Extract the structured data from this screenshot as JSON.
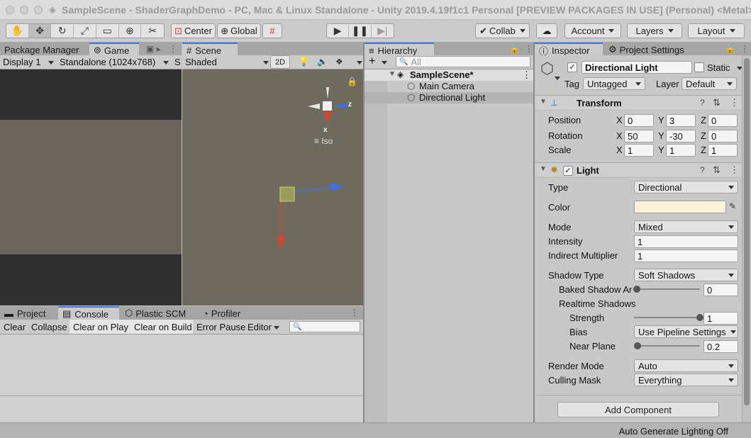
{
  "window": {
    "title": "SampleScene - ShaderGraphDemo - PC, Mac & Linux Standalone - Unity 2019.4.19f1c1 Personal [PREVIEW PACKAGES IN USE] (Personal) <Metal>"
  },
  "toolbar": {
    "tools": [
      "hand-tool",
      "move-tool",
      "rotate-tool",
      "scale-tool",
      "rect-tool",
      "transform-tool",
      "custom-tool"
    ],
    "pivot_label": "Center",
    "space_label": "Global",
    "collab_label": "Collab",
    "account_label": "Account",
    "layers_label": "Layers",
    "layout_label": "Layout"
  },
  "left_tabs": {
    "package_manager": "Package Manager",
    "game": "Game"
  },
  "game": {
    "display": "Display 1",
    "resolution": "Standalone (1024x768)",
    "scale_prefix": "S"
  },
  "scene": {
    "tab": "Scene",
    "shading": "Shaded",
    "mode_2d": "2D",
    "gizmo_x": "x",
    "gizmo_z": "z",
    "iso": "Iso"
  },
  "hierarchy": {
    "tab": "Hierarchy",
    "search_placeholder": "All",
    "scene_name": "SampleScene*",
    "items": [
      "Main Camera",
      "Directional Light"
    ]
  },
  "bottom_tabs": {
    "project": "Project",
    "console": "Console",
    "plastic": "Plastic SCM",
    "profiler": "Profiler"
  },
  "console": {
    "clear": "Clear",
    "collapse": "Collapse",
    "clear_on_play": "Clear on Play",
    "clear_on_build": "Clear on Build",
    "error_pause": "Error Pause",
    "editor": "Editor"
  },
  "inspector": {
    "tab": "Inspector",
    "settings_tab": "Project Settings",
    "object_name": "Directional Light",
    "static_label": "Static",
    "tag_label": "Tag",
    "tag_value": "Untagged",
    "layer_label": "Layer",
    "layer_value": "Default",
    "transform": {
      "title": "Transform",
      "position_label": "Position",
      "rotation_label": "Rotation",
      "scale_label": "Scale",
      "axis_x": "X",
      "axis_y": "Y",
      "axis_z": "Z",
      "position": [
        "0",
        "3",
        "0"
      ],
      "rotation": [
        "50",
        "-30",
        "0"
      ],
      "scale": [
        "1",
        "1",
        "1"
      ]
    },
    "light": {
      "title": "Light",
      "type_label": "Type",
      "type_value": "Directional",
      "color_label": "Color",
      "color_hex": "#fdf4d8",
      "mode_label": "Mode",
      "mode_value": "Mixed",
      "intensity_label": "Intensity",
      "intensity_value": "1",
      "indirect_label": "Indirect Multiplier",
      "indirect_value": "1",
      "shadow_type_label": "Shadow Type",
      "shadow_type_value": "Soft Shadows",
      "baked_angle_label": "Baked Shadow An",
      "baked_angle_value": "0",
      "realtime_label": "Realtime Shadows",
      "strength_label": "Strength",
      "strength_value": "1",
      "bias_label": "Bias",
      "bias_value": "Use Pipeline Settings",
      "near_plane_label": "Near Plane",
      "near_plane_value": "0.2",
      "render_mode_label": "Render Mode",
      "render_mode_value": "Auto",
      "culling_label": "Culling Mask",
      "culling_value": "Everything"
    },
    "add_component": "Add Component"
  },
  "status": {
    "lighting": "Auto Generate Lighting Off"
  },
  "colors": {
    "accent": "#3a78d6",
    "scene_bg": "#6f6a5e",
    "game_bg": "#6b665b",
    "x_axis": "#e0412a",
    "y_axis": "#7fc241",
    "z_axis": "#3d6fe6"
  }
}
